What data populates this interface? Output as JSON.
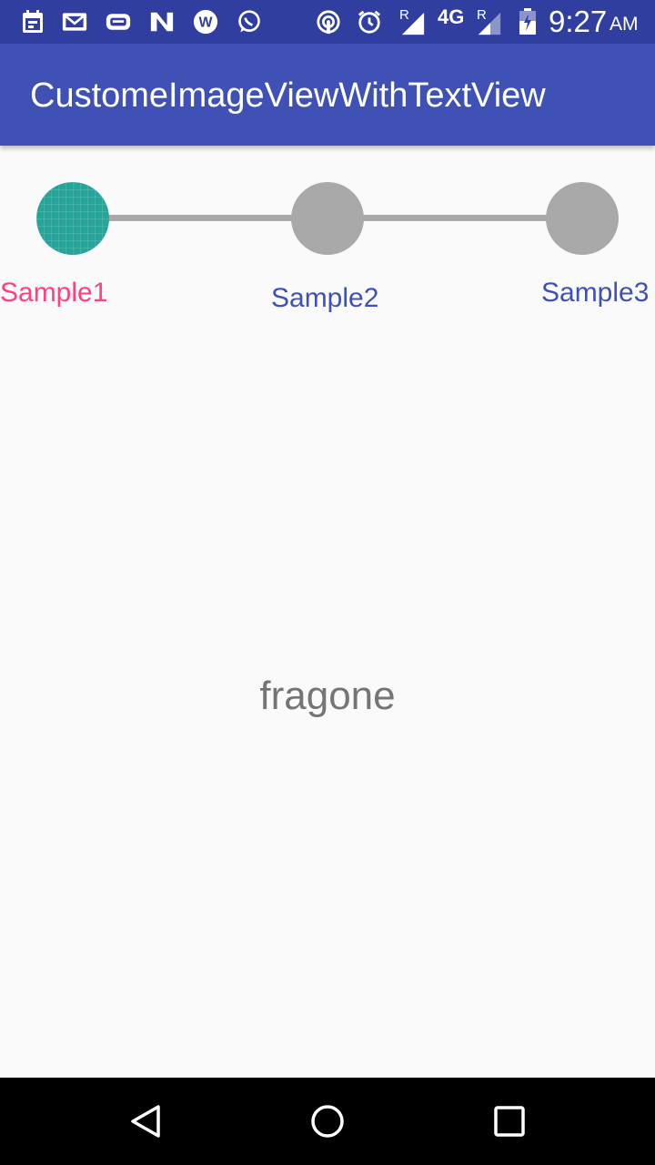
{
  "status_bar": {
    "time": "9:27",
    "ampm": "AM",
    "network": "4G",
    "roaming_1": "R",
    "roaming_2": "R",
    "icons": [
      "calendar-icon",
      "gmail-icon",
      "messenger-icon",
      "n-icon",
      "w-icon",
      "whatsapp-icon",
      "hotspot-icon",
      "alarm-icon",
      "signal-icon",
      "signal-icon-2",
      "battery-icon"
    ]
  },
  "app_bar": {
    "title": "CustomeImageViewWithTextView"
  },
  "stepper": {
    "steps": [
      {
        "label": "Sample1",
        "active": true,
        "label_color": "#ff4081"
      },
      {
        "label": "Sample2",
        "active": false,
        "label_color": "#3f51b5"
      },
      {
        "label": "Sample3",
        "active": false,
        "label_color": "#3f51b5"
      }
    ],
    "active_color": "#26a69a",
    "inactive_color": "#a9a9a9"
  },
  "content": {
    "text": "fragone"
  },
  "nav_bar": {
    "buttons": [
      "back-icon",
      "home-icon",
      "recents-icon"
    ]
  },
  "colors": {
    "status_bar": "#303f9f",
    "app_bar": "#3f51b5",
    "background": "#fafafa"
  }
}
